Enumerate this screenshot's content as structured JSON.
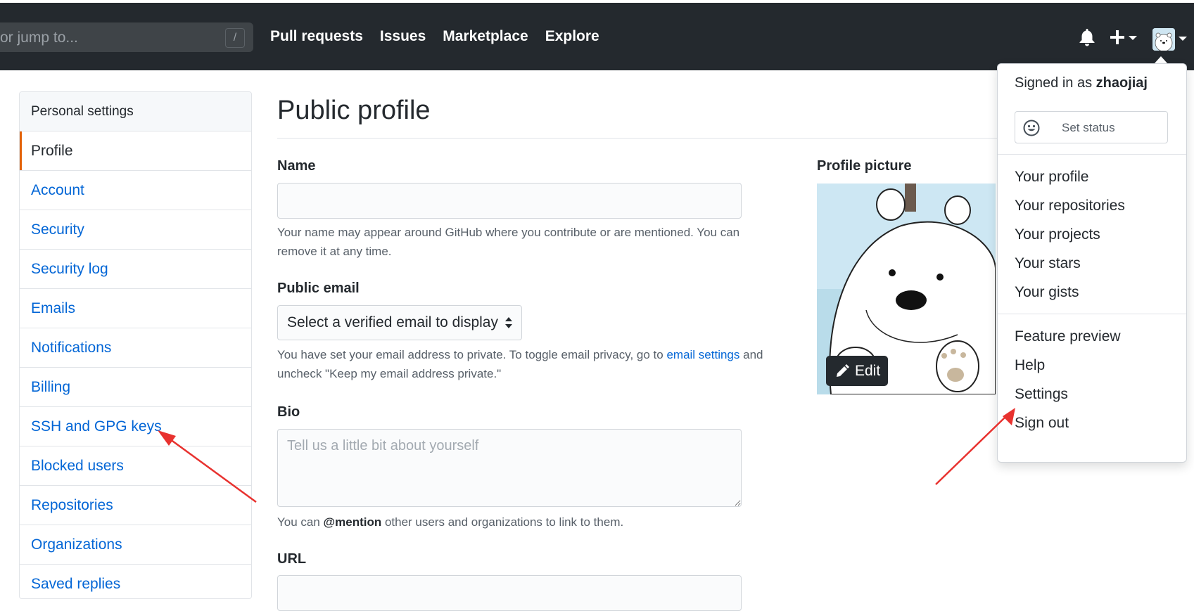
{
  "header": {
    "search_placeholder": "or jump to...",
    "slash_key": "/",
    "nav": [
      "Pull requests",
      "Issues",
      "Marketplace",
      "Explore"
    ],
    "icons": [
      "bell-icon",
      "plus-icon",
      "avatar"
    ]
  },
  "sidebar": {
    "heading": "Personal settings",
    "items": [
      {
        "label": "Profile",
        "selected": true
      },
      {
        "label": "Account"
      },
      {
        "label": "Security"
      },
      {
        "label": "Security log"
      },
      {
        "label": "Emails"
      },
      {
        "label": "Notifications"
      },
      {
        "label": "Billing"
      },
      {
        "label": "SSH and GPG keys"
      },
      {
        "label": "Blocked users"
      },
      {
        "label": "Repositories"
      },
      {
        "label": "Organizations"
      },
      {
        "label": "Saved replies"
      }
    ]
  },
  "main": {
    "title": "Public profile",
    "name": {
      "label": "Name",
      "value": "",
      "note": "Your name may appear around GitHub where you contribute or are mentioned. You can remove it at any time."
    },
    "public_email": {
      "label": "Public email",
      "selected": "Select a verified email to display",
      "note_before": "You have set your email address to private. To toggle email privacy, go to ",
      "note_link": "email settings",
      "note_after": " and uncheck \"Keep my email address private.\""
    },
    "bio": {
      "label": "Bio",
      "placeholder": "Tell us a little bit about yourself",
      "note_before": "You can ",
      "note_mention": "@mention",
      "note_after": " other users and organizations to link to them."
    },
    "url": {
      "label": "URL"
    },
    "profile_picture": {
      "label": "Profile picture",
      "edit_label": "Edit"
    }
  },
  "user_menu": {
    "signed_in_prefix": "Signed in as ",
    "username": "zhaojiaj",
    "set_status": "Set status",
    "items_group1": [
      "Your profile",
      "Your repositories",
      "Your projects",
      "Your stars",
      "Your gists"
    ],
    "items_group2": [
      "Feature preview",
      "Help",
      "Settings",
      "Sign out"
    ]
  },
  "colors": {
    "header_bg": "#24292e",
    "link": "#0366d6",
    "selected_marker": "#e36209",
    "annotation_arrow": "#e8322f"
  }
}
